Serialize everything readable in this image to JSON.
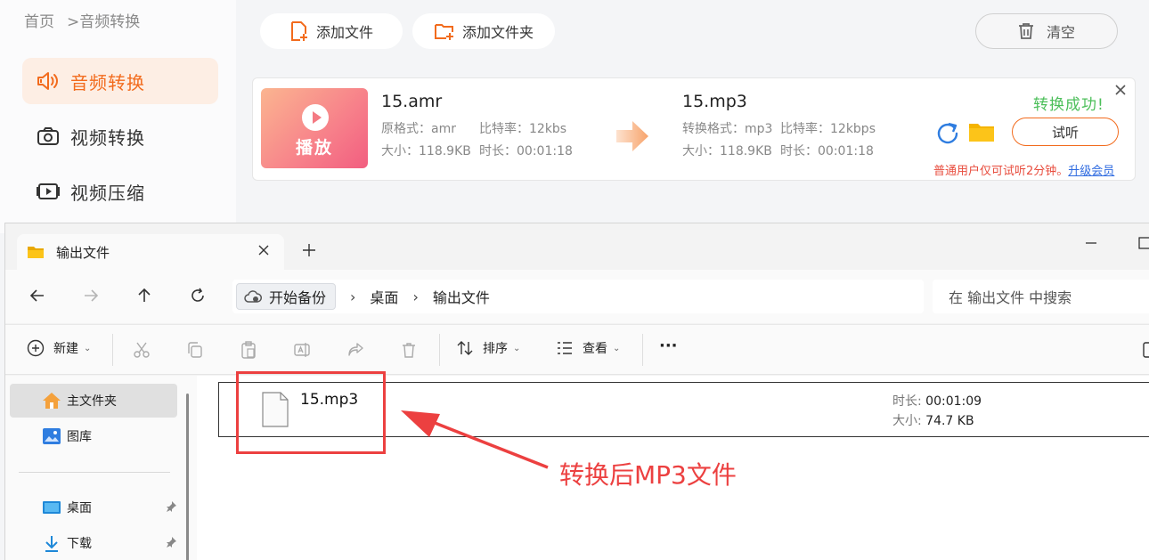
{
  "app": {
    "breadcrumb": {
      "home": "首页",
      "current": ">音频转换"
    },
    "sidebar": [
      {
        "label": "音频转换",
        "active": true,
        "icon": "audio-speaker-icon"
      },
      {
        "label": "视频转换",
        "active": false,
        "icon": "camera-icon"
      },
      {
        "label": "视频压缩",
        "active": false,
        "icon": "video-compress-icon"
      }
    ],
    "toolbar": {
      "add_file": "添加文件",
      "add_folder": "添加文件夹",
      "clear": "清空"
    },
    "task": {
      "thumb_label": "播放",
      "source": {
        "name": "15.amr",
        "format_label": "原格式：",
        "format": "amr",
        "bitrate_label": "比特率：",
        "bitrate": "12kbs",
        "size_label": "大小：",
        "size": "118.9KB",
        "duration_label": "时长：",
        "duration": "00:01:18"
      },
      "target": {
        "name": "15.mp3",
        "format_label": "转换格式：",
        "format": "mp3",
        "bitrate_label": "比特率：",
        "bitrate": "12kbps",
        "size_label": "大小：",
        "size": "118.9KB",
        "duration_label": "时长：",
        "duration": "00:01:18"
      },
      "status": "转换成功!",
      "listen": "试听",
      "notice": "普通用户仅可试听2分钟。",
      "upgrade": "升级会员"
    },
    "colors": {
      "accent": "#f26b1d",
      "success": "#4cbf5a",
      "warning": "#e84c3d",
      "link": "#2f6be0"
    }
  },
  "explorer": {
    "tab_title": "输出文件",
    "address": {
      "root": "开始备份",
      "segments": [
        "桌面",
        "输出文件"
      ]
    },
    "search_placeholder": "在 输出文件 中搜索",
    "commands": {
      "new": "新建",
      "sort": "排序",
      "view": "查看",
      "more": "···"
    },
    "nav": [
      {
        "label": "主文件夹",
        "icon": "home-icon",
        "selected": true
      },
      {
        "label": "图库",
        "icon": "gallery-icon",
        "selected": false
      },
      {
        "label": "桌面",
        "icon": "desktop-icon",
        "selected": false,
        "pinned": true
      },
      {
        "label": "下载",
        "icon": "download-icon",
        "selected": false,
        "pinned": true
      }
    ],
    "file": {
      "name": "15.mp3",
      "duration_label": "时长:",
      "duration": "00:01:09",
      "size_label": "大小:",
      "size": "74.7 KB"
    }
  },
  "annotation": {
    "text": "转换后MP3文件",
    "color": "#ec4040"
  }
}
